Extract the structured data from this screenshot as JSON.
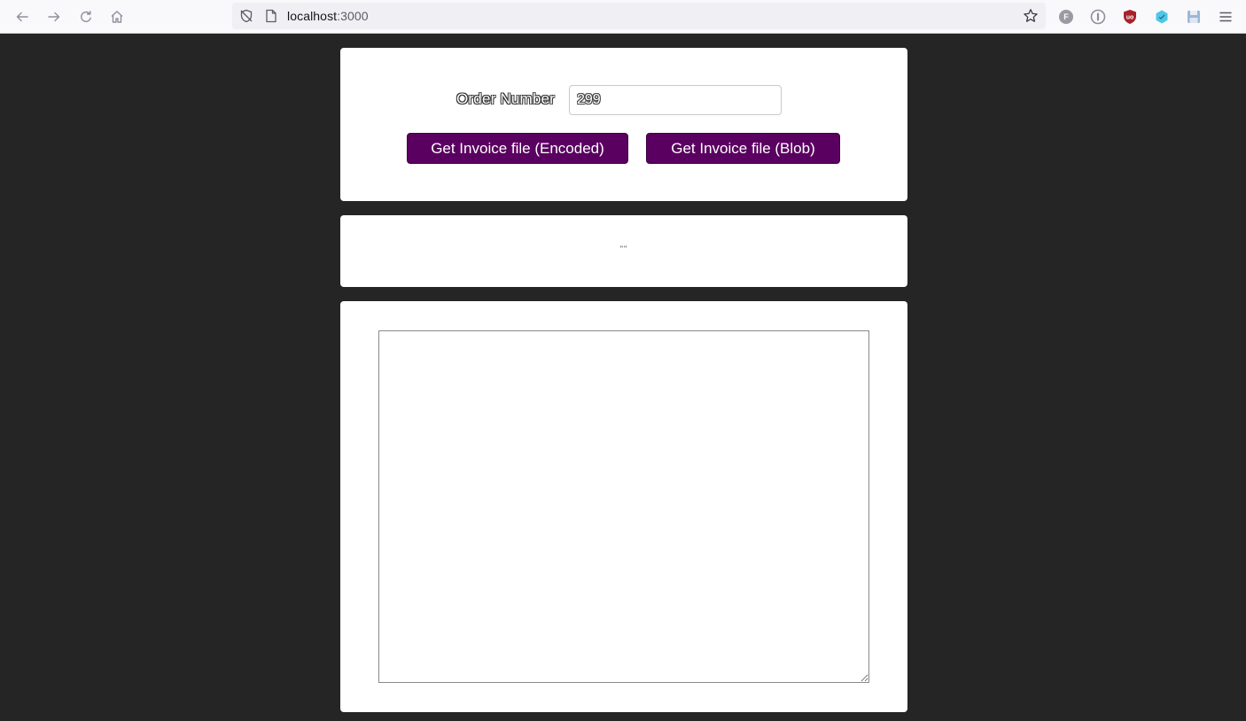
{
  "browser": {
    "url_host": "localhost",
    "url_port": ":3000",
    "icons": [
      "back-arrow-icon",
      "forward-arrow-icon",
      "reload-icon",
      "home-icon",
      "tracking-shield-icon",
      "page-icon",
      "bookmark-star-icon",
      "extension-f-icon",
      "password-manager-icon",
      "ublock-icon",
      "extension-cyan-icon",
      "save-icon",
      "menu-icon"
    ],
    "extension_letters": {
      "f": "F",
      "ublock": "uo"
    }
  },
  "form": {
    "order_label": "Order Number",
    "order_value": "299",
    "btn_encoded": "Get Invoice file (Encoded)",
    "btn_blob": "Get Invoice file (Blob)"
  },
  "status": {
    "text": "\"\""
  },
  "output": {
    "value": ""
  },
  "colors": {
    "page_background": "#252525",
    "card_background": "#ffffff",
    "button_background": "#5a0060",
    "button_text": "#ffffff"
  }
}
